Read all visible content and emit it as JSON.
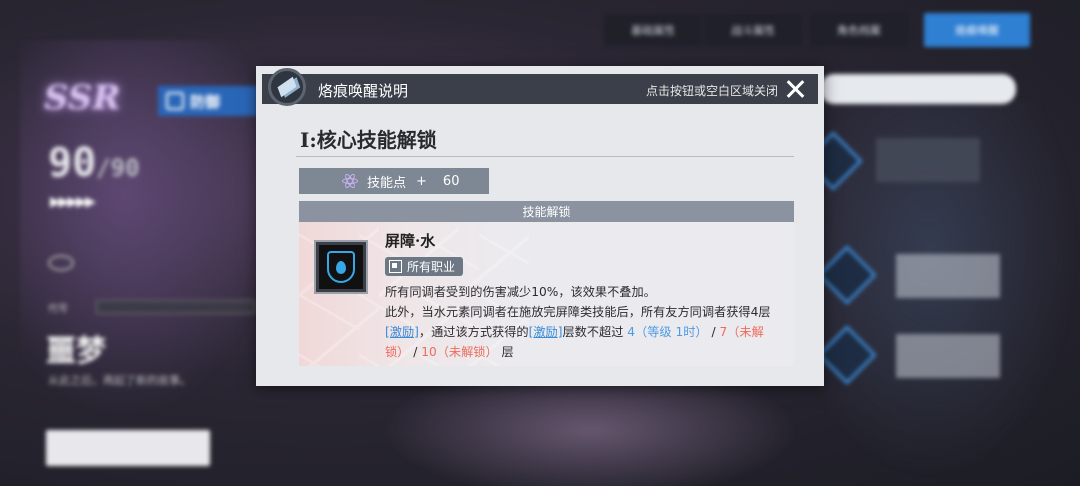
{
  "background": {
    "tabs": [
      {
        "label": "基础属性",
        "active": false
      },
      {
        "label": "战斗属性",
        "active": false
      },
      {
        "label": "角色档案",
        "active": false
      },
      {
        "label": "烙痕唤醒",
        "active": true
      }
    ],
    "rarity": "SSR",
    "class_label": "防御",
    "level": "90",
    "level_max": "/90",
    "arrows": "▶▶▶▶▶",
    "codename_label": "代号",
    "character_name": "噩梦",
    "character_desc": "从此之后，再起了新的故事。"
  },
  "dialog": {
    "title": "烙痕唤醒说明",
    "close_hint": "点击按钮或空白区域关闭",
    "section_title": "I:核心技能解锁",
    "skill_points_label": "技能点",
    "skill_points_plus": "+",
    "skill_points_value": "60",
    "panel_header": "技能解锁",
    "skill": {
      "name": "屏障·水",
      "job_tag": "所有职业",
      "line1": "所有同调者受到的伤害减少10%，该效果不叠加。",
      "line2a": "此外，当水元素同调者在施放完屏障类技能后，所有友方同调者获得4层",
      "kw1": "[激励]",
      "line2b": "，通过该方式获得的",
      "kw2": "[激励]",
      "line2c": "层数不超过 ",
      "lv1": "4（等级 1时）",
      "sep1": " / ",
      "lv2": "7（未解锁）",
      "sep2": " / ",
      "lv3": "10（未解锁）",
      "tail": " 层"
    },
    "colors": {
      "header_bg": "#3a3f49",
      "accent_blue": "#4f9be3",
      "locked_red": "#ee6b5c"
    }
  }
}
